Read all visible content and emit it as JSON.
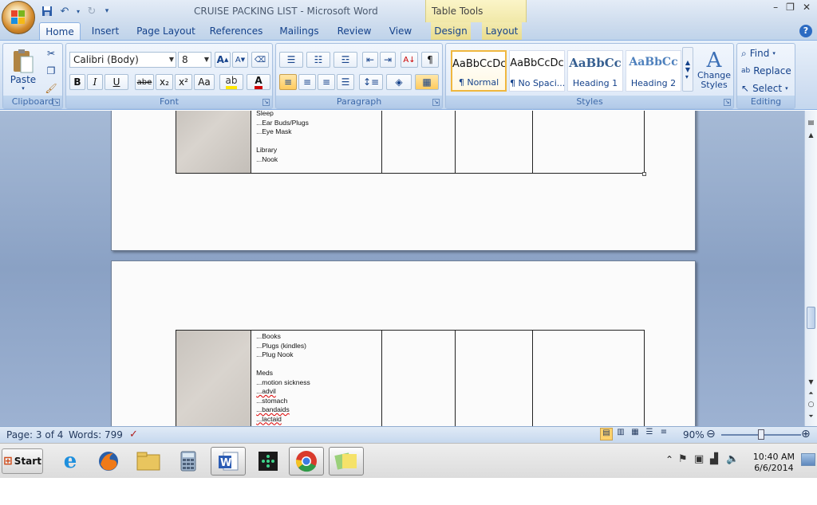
{
  "window": {
    "title": "CRUISE PACKING LIST - Microsoft Word",
    "context_tab": "Table Tools"
  },
  "quick_access": [
    "save-icon",
    "undo-icon",
    "redo-icon",
    "customize-icon"
  ],
  "tabs": [
    "Home",
    "Insert",
    "Page Layout",
    "References",
    "Mailings",
    "Review",
    "View",
    "Design",
    "Layout"
  ],
  "active_tab": "Home",
  "ribbon": {
    "clipboard": {
      "label": "Clipboard",
      "paste": "Paste"
    },
    "font": {
      "label": "Font",
      "name": "Calibri (Body)",
      "size": "8",
      "bold": "B",
      "italic": "I",
      "underline": "U",
      "strike": "abe",
      "sub": "x₂",
      "sup": "x²",
      "case": "Aa"
    },
    "paragraph": {
      "label": "Paragraph",
      "pilcrow": "¶"
    },
    "styles": {
      "label": "Styles",
      "items": [
        {
          "preview": "AaBbCcDc",
          "name": "¶ Normal"
        },
        {
          "preview": "AaBbCcDc",
          "name": "¶ No Spaci..."
        },
        {
          "preview": "AaBbCc",
          "name": "Heading 1"
        },
        {
          "preview": "AaBbCc",
          "name": "Heading 2"
        }
      ],
      "change": "Change Styles"
    },
    "editing": {
      "label": "Editing",
      "find": "Find",
      "replace": "Replace",
      "select": "Select"
    }
  },
  "document": {
    "page1_lines": [
      "Sleep",
      "...Ear Buds/Plugs",
      "...Eye Mask",
      "",
      "Library",
      "...Nook"
    ],
    "page2_lines": [
      "...Books",
      "...Plugs (kindles)",
      "...Plug Nook",
      "",
      "Meds",
      "...motion sickness",
      "...advil",
      "...stomach",
      "...bandaids",
      "...lactaid"
    ]
  },
  "status": {
    "page": "Page: 3 of 4",
    "words": "Words: 799",
    "zoom": "90%",
    "zoom_fraction": 0.5
  },
  "taskbar": {
    "start": "Start",
    "apps": [
      "ie-icon",
      "firefox-icon",
      "explorer-icon",
      "calculator-icon",
      "word-icon",
      "media-icon",
      "chrome-icon",
      "notes-icon"
    ],
    "active_app": "word-icon",
    "time": "10:40 AM",
    "date": "6/6/2014"
  },
  "colors": {
    "ribbon": "#d0def1",
    "doc_bg": "#8aa1c4",
    "selected_style": "#f0b73e",
    "context_tab": "#f1e8a8"
  }
}
